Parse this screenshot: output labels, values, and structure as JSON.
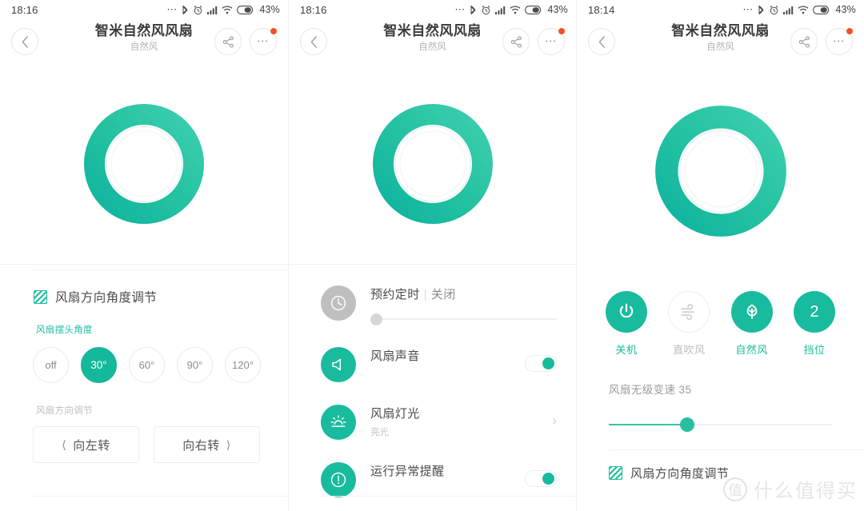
{
  "panels": [
    {
      "status": {
        "time": "18:16",
        "dots": "…",
        "battery_pct": "43%"
      },
      "nav": {
        "title": "智米自然风风扇",
        "subtitle": "自然风"
      }
    },
    {
      "status": {
        "time": "18:16",
        "dots": "…",
        "battery_pct": "43%"
      },
      "nav": {
        "title": "智米自然风风扇",
        "subtitle": "自然风"
      }
    },
    {
      "status": {
        "time": "18:14",
        "dots": "…",
        "battery_pct": "43%"
      },
      "nav": {
        "title": "智米自然风风扇",
        "subtitle": "自然风"
      }
    }
  ],
  "left": {
    "section_title": "风扇方向角度调节",
    "angle_label": "风扇摆头角度",
    "angles": [
      {
        "label": "off",
        "active": false
      },
      {
        "label": "30°",
        "active": true
      },
      {
        "label": "60°",
        "active": false
      },
      {
        "label": "90°",
        "active": false
      },
      {
        "label": "120°",
        "active": false
      }
    ],
    "direction_label": "风扇方向调节",
    "turn_left": "向左转",
    "turn_right": "向右转"
  },
  "middle": {
    "rows": [
      {
        "icon": "clock-icon",
        "title": "预约定时",
        "sep": "|",
        "value": "关闭",
        "control": "slider",
        "slider_pct": 0
      },
      {
        "icon": "speaker-icon",
        "title": "风扇声音",
        "control": "switch",
        "switch_on": true
      },
      {
        "icon": "light-icon",
        "title": "风扇灯光",
        "subtitle": "亮光",
        "control": "arrow"
      },
      {
        "icon": "alert-icon",
        "title": "运行异常提醒",
        "control": "switch",
        "switch_on": true
      }
    ]
  },
  "right": {
    "modes": [
      {
        "icon": "power-icon",
        "glyph": "⏻",
        "label": "关机",
        "active": true
      },
      {
        "icon": "wind-icon",
        "glyph": "",
        "label": "直吹风",
        "active": false
      },
      {
        "icon": "leaf-icon",
        "glyph": "",
        "label": "自然风",
        "active": true
      },
      {
        "icon": "gear-level-icon",
        "glyph": "2",
        "label": "挡位",
        "active": true
      }
    ],
    "speed_label": "风扇无级变速 35",
    "speed_value": 35,
    "section_title": "风扇方向角度调节"
  },
  "watermark": {
    "mark": "值",
    "text": "什么值得买"
  },
  "colors": {
    "accent": "#18bb9d",
    "accent_dark": "#14b89b",
    "badge": "#f4511e",
    "muted": "#bdbdbd"
  }
}
